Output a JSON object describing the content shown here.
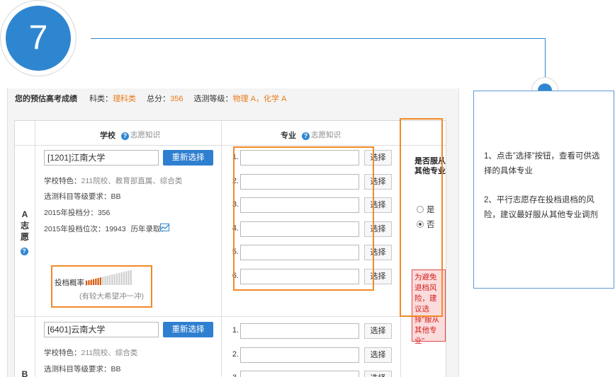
{
  "step": {
    "number": "7"
  },
  "instructions": {
    "items": [
      "1、点击”选择”按钮，查看可供选择的具体专业",
      "2、平行志愿存在投档退档的风险，建议最好服从其他专业调剂"
    ]
  },
  "score_bar": {
    "title": "您的预估高考成绩",
    "subject_label": "科类：",
    "subject_value": "理科类",
    "total_label": "总分：",
    "total_value": "356",
    "grade_label": "选测等级：",
    "grade_value": "物理 A，化学 A"
  },
  "table": {
    "school_header": "学校",
    "school_help": "志愿知识",
    "major_header": "专业",
    "major_help": "志愿知识",
    "accept_header_line1": "是否服从",
    "accept_header_line2": "其他专业",
    "help_icon": "question-circle-icon"
  },
  "wish_a": {
    "label_letter": "A",
    "label_line1": "志",
    "label_line2": "愿",
    "school_value": "[1201]江南大学",
    "reselect_label": "重新选择",
    "features_label": "学校特色：",
    "features_value": "211院校、教育部直属、综合类",
    "grade_req_label": "选测科目等级要求：",
    "grade_req_value": "BB",
    "score_2015_label": "2015年投档分：",
    "score_2015_value": "356",
    "rank_2015_label": "2015年投档位次：",
    "rank_2015_value": "19943",
    "history_label": "历年录取：",
    "history_icon": "trend-chart-icon",
    "prob_label": "投档概率：",
    "prob_level": 0.35,
    "prob_hint": "(有较大希望冲一冲)",
    "majors": [
      {
        "num": "1.",
        "select": "选择"
      },
      {
        "num": "2.",
        "select": "选择"
      },
      {
        "num": "3.",
        "select": "选择"
      },
      {
        "num": "4.",
        "select": "选择"
      },
      {
        "num": "5.",
        "select": "选择"
      },
      {
        "num": "6.",
        "select": "选择"
      }
    ],
    "accept_yes": "是",
    "accept_no": "否",
    "accept_selected": "否",
    "warning": "为避免退档风险，建议选择”服从其他专业”"
  },
  "wish_b": {
    "label_letter": "B",
    "school_value": "[6401]云南大学",
    "reselect_label": "重新选择",
    "features_label": "学校特色：",
    "features_value": "211院校、综合类",
    "grade_req_label": "选测科目等级要求：",
    "grade_req_value": "BB",
    "majors": [
      {
        "num": "1.",
        "select": "选择"
      },
      {
        "num": "2.",
        "select": "选择"
      },
      {
        "num": "3.",
        "select": "选择"
      }
    ]
  },
  "colors": {
    "accent": "#2f86d0",
    "highlight": "#f08a28",
    "warning": "#d42020"
  }
}
